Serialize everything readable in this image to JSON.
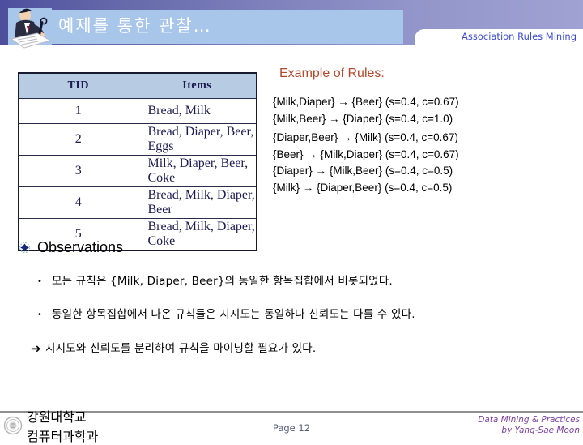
{
  "header": {
    "title": "예제를 통한 관찰…",
    "subtitle": "Association Rules Mining",
    "presenter_icon": "presenter-clipart-icon",
    "band_color": "#7d80bb",
    "title_bar_color": "#a8c6ea",
    "subtitle_color": "#3a4bd0"
  },
  "table": {
    "columns": [
      "TID",
      "Items"
    ],
    "header_bg": "#b7cce3",
    "rows": [
      {
        "tid": "1",
        "items": "Bread, Milk"
      },
      {
        "tid": "2",
        "items": "Bread, Diaper, Beer, Eggs"
      },
      {
        "tid": "3",
        "items": "Milk, Diaper, Beer, Coke"
      },
      {
        "tid": "4",
        "items": "Bread, Milk, Diaper, Beer"
      },
      {
        "tid": "5",
        "items": "Bread, Milk, Diaper, Coke"
      }
    ]
  },
  "rules": {
    "heading": "Example of Rules:",
    "heading_color": "#b1482a",
    "items": [
      "{Milk,Diaper} → {Beer} (s=0.4, c=0.67)",
      "{Milk,Beer} → {Diaper} (s=0.4, c=1.0)",
      "{Diaper,Beer} → {Milk} (s=0.4, c=0.67)",
      "{Beer} → {Milk,Diaper} (s=0.4, c=0.67)",
      "{Diaper} → {Milk,Beer} (s=0.4, c=0.5)",
      "{Milk} → {Diaper,Beer} (s=0.4, c=0.5)"
    ]
  },
  "observations": {
    "heading": "Observations",
    "bullet_icon": "diamond-bullet-icon",
    "items": [
      {
        "marker": "•",
        "text": "모든 규칙은 {Milk, Diaper, Beer}의 동일한 항목집합에서 비롯되었다."
      },
      {
        "marker": "•",
        "text": "동일한 항목집합에서 나온 규칙들은 지지도는 동일하나 신뢰도는 다를 수 있다."
      },
      {
        "marker": "➔",
        "text": "지지도와 신뢰도를 분리하여 규칙을 마이닝할 필요가 있다."
      }
    ]
  },
  "footer": {
    "logo_icon": "university-emblem-icon",
    "logo_line1": "강원대학교",
    "logo_line2": "컴퓨터과학과",
    "page_label": "Page 12",
    "credit_line1": "Data Mining & Practices",
    "credit_line2": "by Yang-Sae Moon",
    "credit_color": "#7b3fa0"
  }
}
